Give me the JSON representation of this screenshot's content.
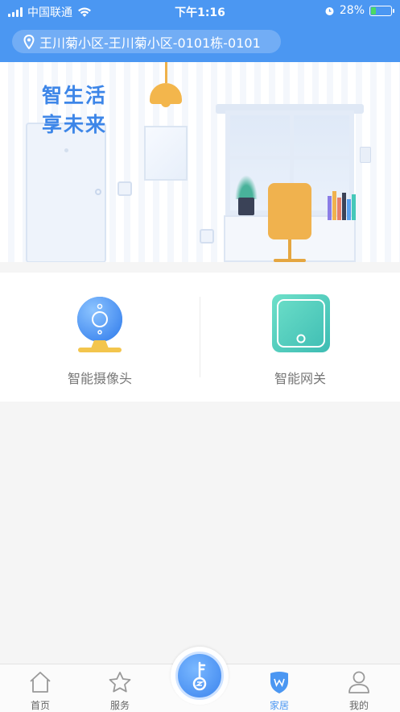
{
  "status_bar": {
    "carrier": "中国联通",
    "time": "下午1:16",
    "battery_percent": "28%",
    "battery_level": 0.28
  },
  "location": {
    "address": "王川菊小区-王川菊小区-0101栋-0101",
    "icon": "location-pin-icon"
  },
  "banner": {
    "slogan_line1": "智生活",
    "slogan_line2": "享未来"
  },
  "devices": [
    {
      "label": "智能摄像头",
      "icon": "camera-icon"
    },
    {
      "label": "智能网关",
      "icon": "gateway-icon"
    }
  ],
  "tabbar": {
    "items": [
      {
        "label": "首页",
        "icon": "home-icon",
        "active": false
      },
      {
        "label": "服务",
        "icon": "star-icon",
        "active": false
      },
      {
        "label": "家居",
        "icon": "home-shield-icon",
        "active": true
      },
      {
        "label": "我的",
        "icon": "user-icon",
        "active": false
      }
    ],
    "center_icon": "key-icon"
  },
  "colors": {
    "primary": "#4b97f2",
    "accent_orange": "#f0b24e",
    "gateway_teal": "#45c8b9"
  }
}
